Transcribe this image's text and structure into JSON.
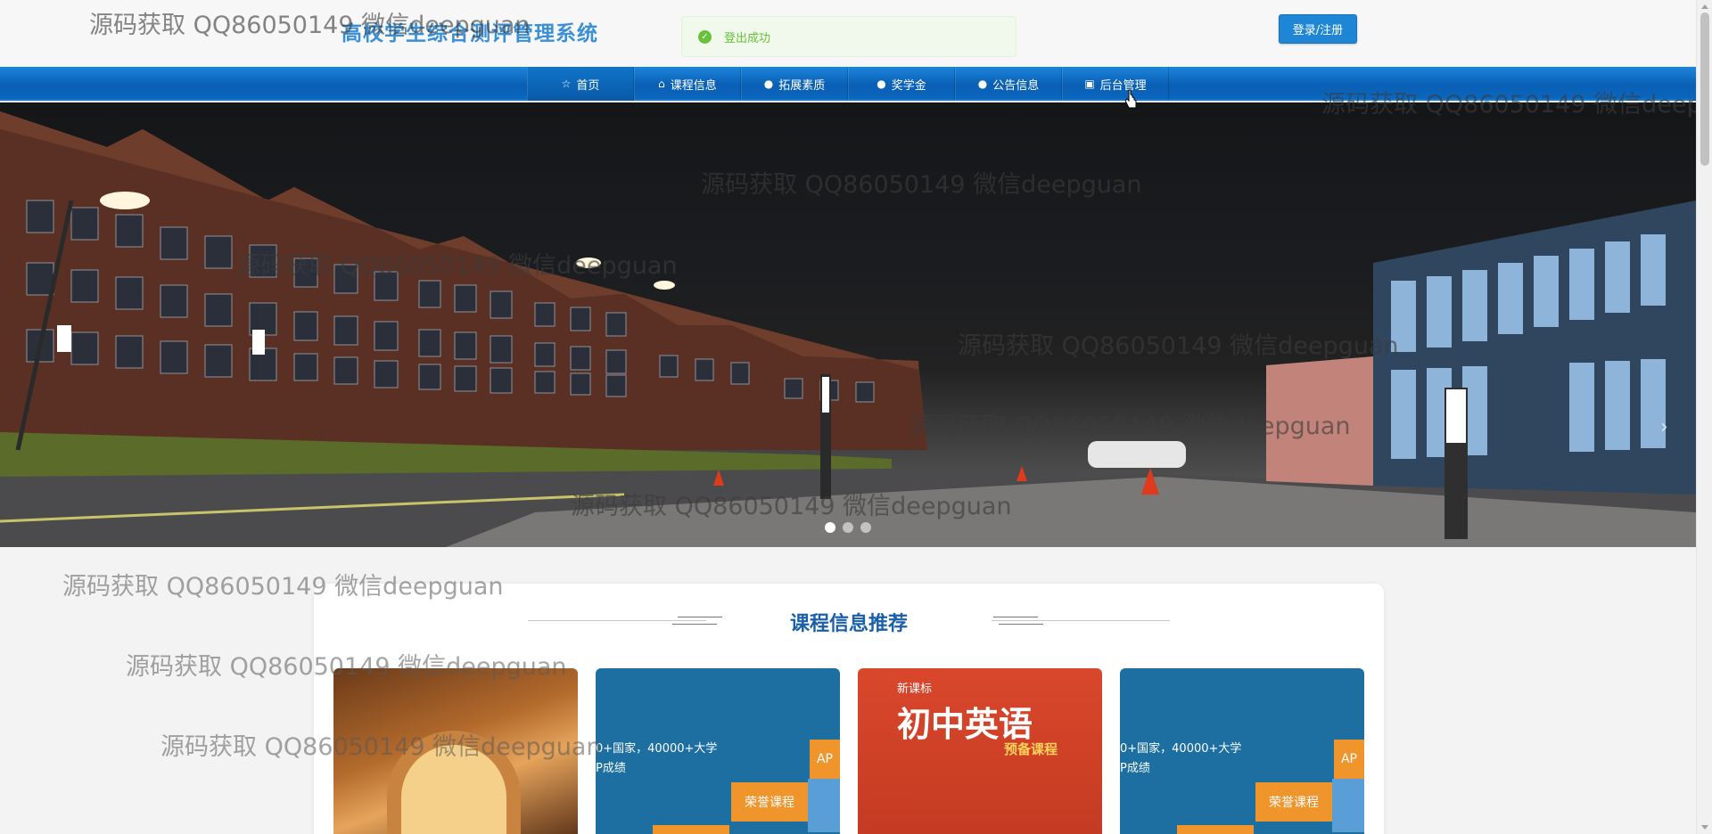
{
  "header": {
    "site_title": "高校学生综合测评管理系统",
    "login_label": "登录/注册"
  },
  "toast": {
    "message": "登出成功",
    "icon": "check-circle-icon",
    "color": "#67c23a"
  },
  "nav": {
    "items": [
      {
        "label": "首页",
        "icon": "star-icon"
      },
      {
        "label": "课程信息",
        "icon": "bag-icon"
      },
      {
        "label": "拓展素质",
        "icon": "info-icon"
      },
      {
        "label": "奖学金",
        "icon": "question-icon"
      },
      {
        "label": "公告信息",
        "icon": "info-icon"
      },
      {
        "label": "后台管理",
        "icon": "clipboard-icon"
      }
    ]
  },
  "banner": {
    "active_slide": 1,
    "slide_count": 3
  },
  "section": {
    "title": "课程信息推荐",
    "cards": [
      {
        "image": "library"
      },
      {
        "line1": "0+国家，40000+大学",
        "line2": "P成绩",
        "tag": "荣誉课程",
        "corner": "AP"
      },
      {
        "book_series": "新课标",
        "book_title": "初中英语",
        "book_sub": "预备课程"
      },
      {
        "line1": "0+国家，40000+大学",
        "line2": "P成绩",
        "tag": "荣誉课程",
        "corner": "AP"
      }
    ]
  },
  "watermark": {
    "text": "源码获取 QQ86050149 微信deepguan"
  },
  "colors": {
    "accent": "#1f86d6",
    "nav": "#0a5fb4",
    "title": "#1a5fa8"
  }
}
